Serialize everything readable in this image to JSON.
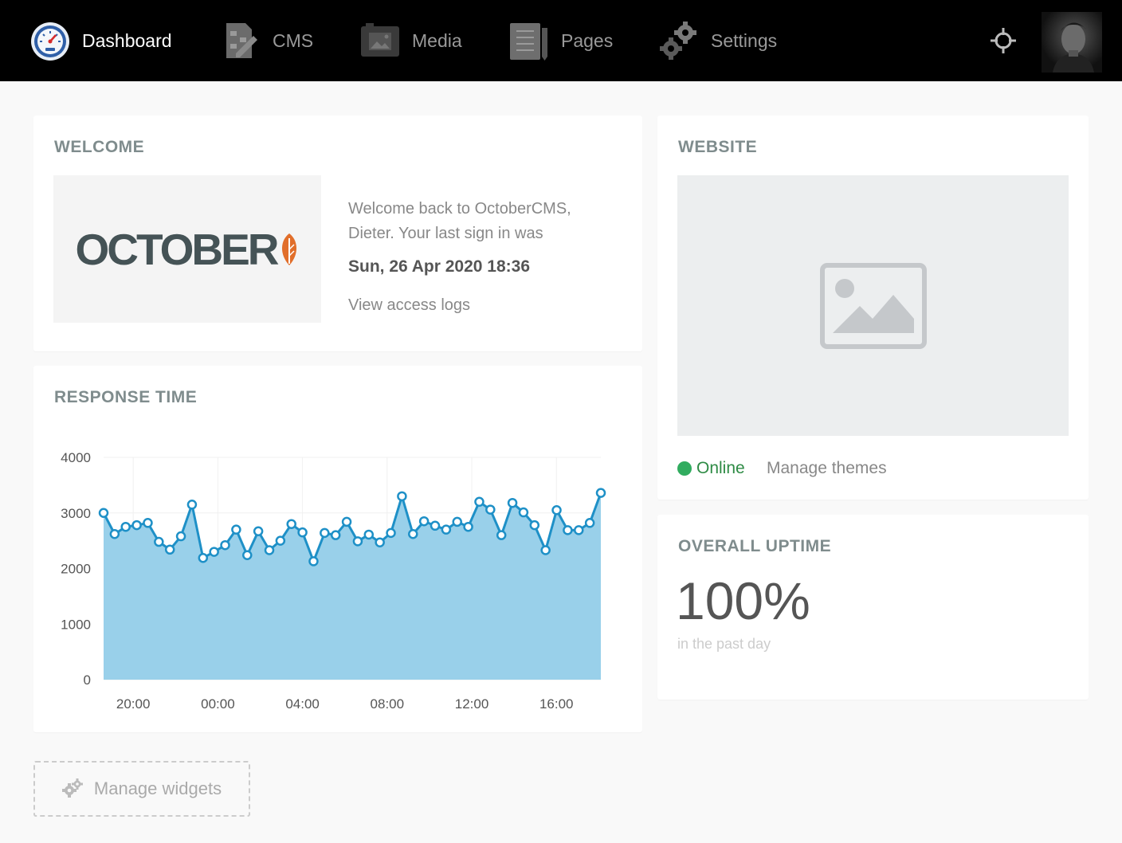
{
  "nav": {
    "items": [
      {
        "label": "Dashboard",
        "icon": "dashboard-gauge-icon",
        "active": true
      },
      {
        "label": "CMS",
        "icon": "cms-icon",
        "active": false
      },
      {
        "label": "Media",
        "icon": "media-icon",
        "active": false
      },
      {
        "label": "Pages",
        "icon": "pages-icon",
        "active": false
      },
      {
        "label": "Settings",
        "icon": "settings-gears-icon",
        "active": false
      }
    ],
    "preview_icon": "crosshair-icon",
    "avatar": "user-avatar"
  },
  "welcome": {
    "title": "Welcome",
    "logo_text": "OCTOBER",
    "message": "Welcome back to OctoberCMS, Dieter. Your last sign in was",
    "last_sign_in": "Sun, 26 Apr 2020 18:36",
    "access_logs_link": "View access logs"
  },
  "response_time": {
    "title": "Response time"
  },
  "website": {
    "title": "Website",
    "status": "Online",
    "status_color": "#31ac5f",
    "manage_themes": "Manage themes"
  },
  "uptime": {
    "title": "Overall uptime",
    "value": "100%",
    "subtitle": "in the past day"
  },
  "manage_widgets": {
    "label": "Manage widgets"
  },
  "colors": {
    "line": "#1e90c7",
    "area": "#99d0ea",
    "accent_leaf": "#e16e2a"
  },
  "chart_data": {
    "type": "area",
    "ylim": [
      0,
      4000
    ],
    "yticks": [
      "4000",
      "3000",
      "2000",
      "1000",
      "0"
    ],
    "xticks": [
      "20:00",
      "00:00",
      "04:00",
      "08:00",
      "12:00",
      "16:00"
    ],
    "xtick_hours": [
      20,
      24,
      28,
      32,
      36,
      40
    ],
    "x_start_hour": 18.6,
    "x_end_hour": 42.1,
    "values": [
      3000,
      2620,
      2750,
      2780,
      2820,
      2480,
      2340,
      2580,
      3150,
      2190,
      2300,
      2420,
      2700,
      2240,
      2670,
      2330,
      2500,
      2800,
      2650,
      2130,
      2640,
      2600,
      2840,
      2490,
      2610,
      2470,
      2640,
      3300,
      2620,
      2850,
      2770,
      2700,
      2840,
      2750,
      3200,
      3060,
      2600,
      3180,
      3010,
      2780,
      2330,
      3050,
      2690,
      2690,
      2820,
      3360
    ]
  }
}
